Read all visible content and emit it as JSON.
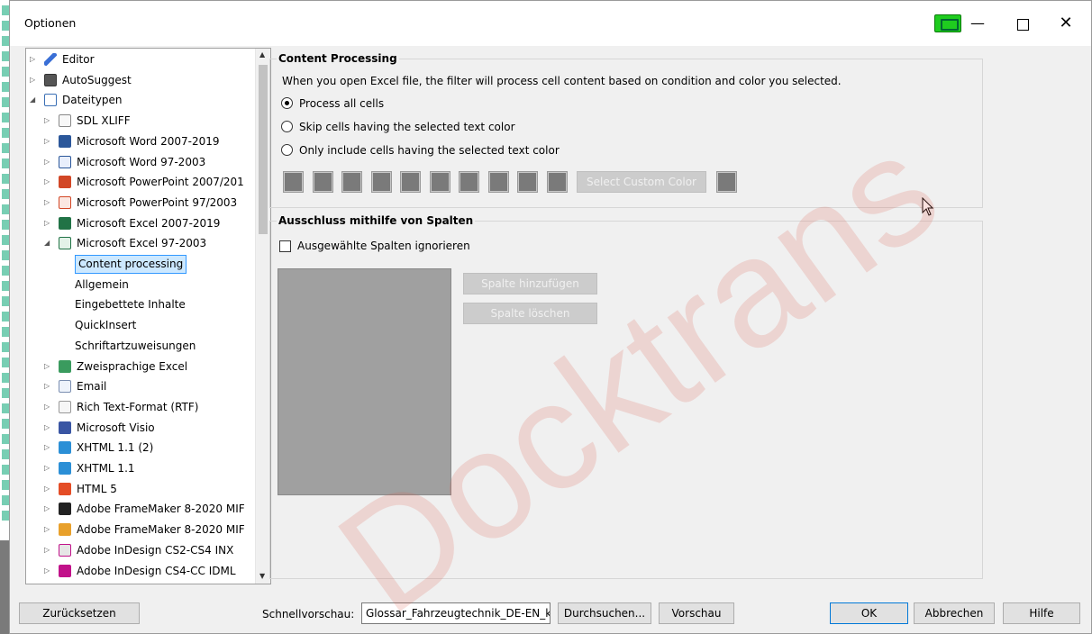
{
  "window": {
    "title": "Optionen"
  },
  "tree": {
    "items": [
      {
        "label": "Editor",
        "icon": "pencil-icon",
        "level": 0,
        "expander": "collapsed"
      },
      {
        "label": "AutoSuggest",
        "icon": "autosuggest-icon",
        "level": 0,
        "expander": "collapsed"
      },
      {
        "label": "Dateitypen",
        "icon": "filetypes-icon",
        "level": 0,
        "expander": "expanded"
      },
      {
        "label": "SDL XLIFF",
        "icon": "sdlxliff-icon",
        "level": 1,
        "expander": "collapsed"
      },
      {
        "label": "Microsoft Word 2007-2019",
        "icon": "word-icon",
        "level": 1,
        "expander": "collapsed"
      },
      {
        "label": "Microsoft Word 97-2003",
        "icon": "word97-icon",
        "level": 1,
        "expander": "collapsed"
      },
      {
        "label": "Microsoft PowerPoint 2007/201",
        "icon": "powerpoint-icon",
        "level": 1,
        "expander": "collapsed"
      },
      {
        "label": "Microsoft PowerPoint 97/2003",
        "icon": "powerpoint97-icon",
        "level": 1,
        "expander": "collapsed"
      },
      {
        "label": "Microsoft Excel 2007-2019",
        "icon": "excel-icon",
        "level": 1,
        "expander": "collapsed"
      },
      {
        "label": "Microsoft Excel 97-2003",
        "icon": "excel97-icon",
        "level": 1,
        "expander": "expanded"
      },
      {
        "label": "Content processing",
        "icon": "",
        "level": 2,
        "expander": "none",
        "selected": true
      },
      {
        "label": "Allgemein",
        "icon": "",
        "level": 2,
        "expander": "none"
      },
      {
        "label": "Eingebettete Inhalte",
        "icon": "",
        "level": 2,
        "expander": "none"
      },
      {
        "label": "QuickInsert",
        "icon": "",
        "level": 2,
        "expander": "none"
      },
      {
        "label": "Schriftartzuweisungen",
        "icon": "",
        "level": 2,
        "expander": "none"
      },
      {
        "label": "Zweisprachige Excel",
        "icon": "bilingual-excel-icon",
        "level": 1,
        "expander": "collapsed"
      },
      {
        "label": "Email",
        "icon": "email-icon",
        "level": 1,
        "expander": "collapsed"
      },
      {
        "label": "Rich Text-Format (RTF)",
        "icon": "rtf-icon",
        "level": 1,
        "expander": "collapsed"
      },
      {
        "label": "Microsoft Visio",
        "icon": "visio-icon",
        "level": 1,
        "expander": "collapsed"
      },
      {
        "label": "XHTML 1.1 (2)",
        "icon": "xhtml-icon",
        "level": 1,
        "expander": "collapsed"
      },
      {
        "label": "XHTML 1.1",
        "icon": "xhtml-icon",
        "level": 1,
        "expander": "collapsed"
      },
      {
        "label": "HTML 5",
        "icon": "html5-icon",
        "level": 1,
        "expander": "collapsed"
      },
      {
        "label": "Adobe FrameMaker 8-2020 MIF",
        "icon": "framemaker-icon",
        "level": 1,
        "expander": "collapsed"
      },
      {
        "label": "Adobe FrameMaker 8-2020 MIF",
        "icon": "framemaker2-icon",
        "level": 1,
        "expander": "collapsed"
      },
      {
        "label": "Adobe InDesign CS2-CS4 INX",
        "icon": "indesign-inx-icon",
        "level": 1,
        "expander": "collapsed"
      },
      {
        "label": "Adobe InDesign CS4-CC IDML",
        "icon": "indesign-idml-icon",
        "level": 1,
        "expander": "collapsed"
      }
    ]
  },
  "content_processing": {
    "title": "Content Processing",
    "description": "When you open Excel file, the filter will process cell content based on condition and color you selected.",
    "options": [
      {
        "label": "Process all cells",
        "selected": true
      },
      {
        "label": "Skip cells having the selected text color",
        "selected": false
      },
      {
        "label": "Only include cells having the selected text color",
        "selected": false
      }
    ],
    "custom_color_button": "Select Custom Color",
    "swatch_color": "#7a7a7a"
  },
  "columns": {
    "title": "Ausschluss mithilfe von Spalten",
    "ignore_checkbox": "Ausgewählte Spalten ignorieren",
    "ignore_checked": false,
    "add_button": "Spalte hinzufügen",
    "remove_button": "Spalte löschen"
  },
  "footer": {
    "reset_button": "Zurücksetzen",
    "quick_preview_label": "Schnellvorschau:",
    "quick_preview_value": "Glossar_Fahrzeugtechnik_DE-EN_k",
    "browse_button": "Durchsuchen...",
    "preview_button": "Vorschau",
    "ok_button": "OK",
    "cancel_button": "Abbrechen",
    "help_button": "Hilfe"
  },
  "watermark": "Docktrans"
}
